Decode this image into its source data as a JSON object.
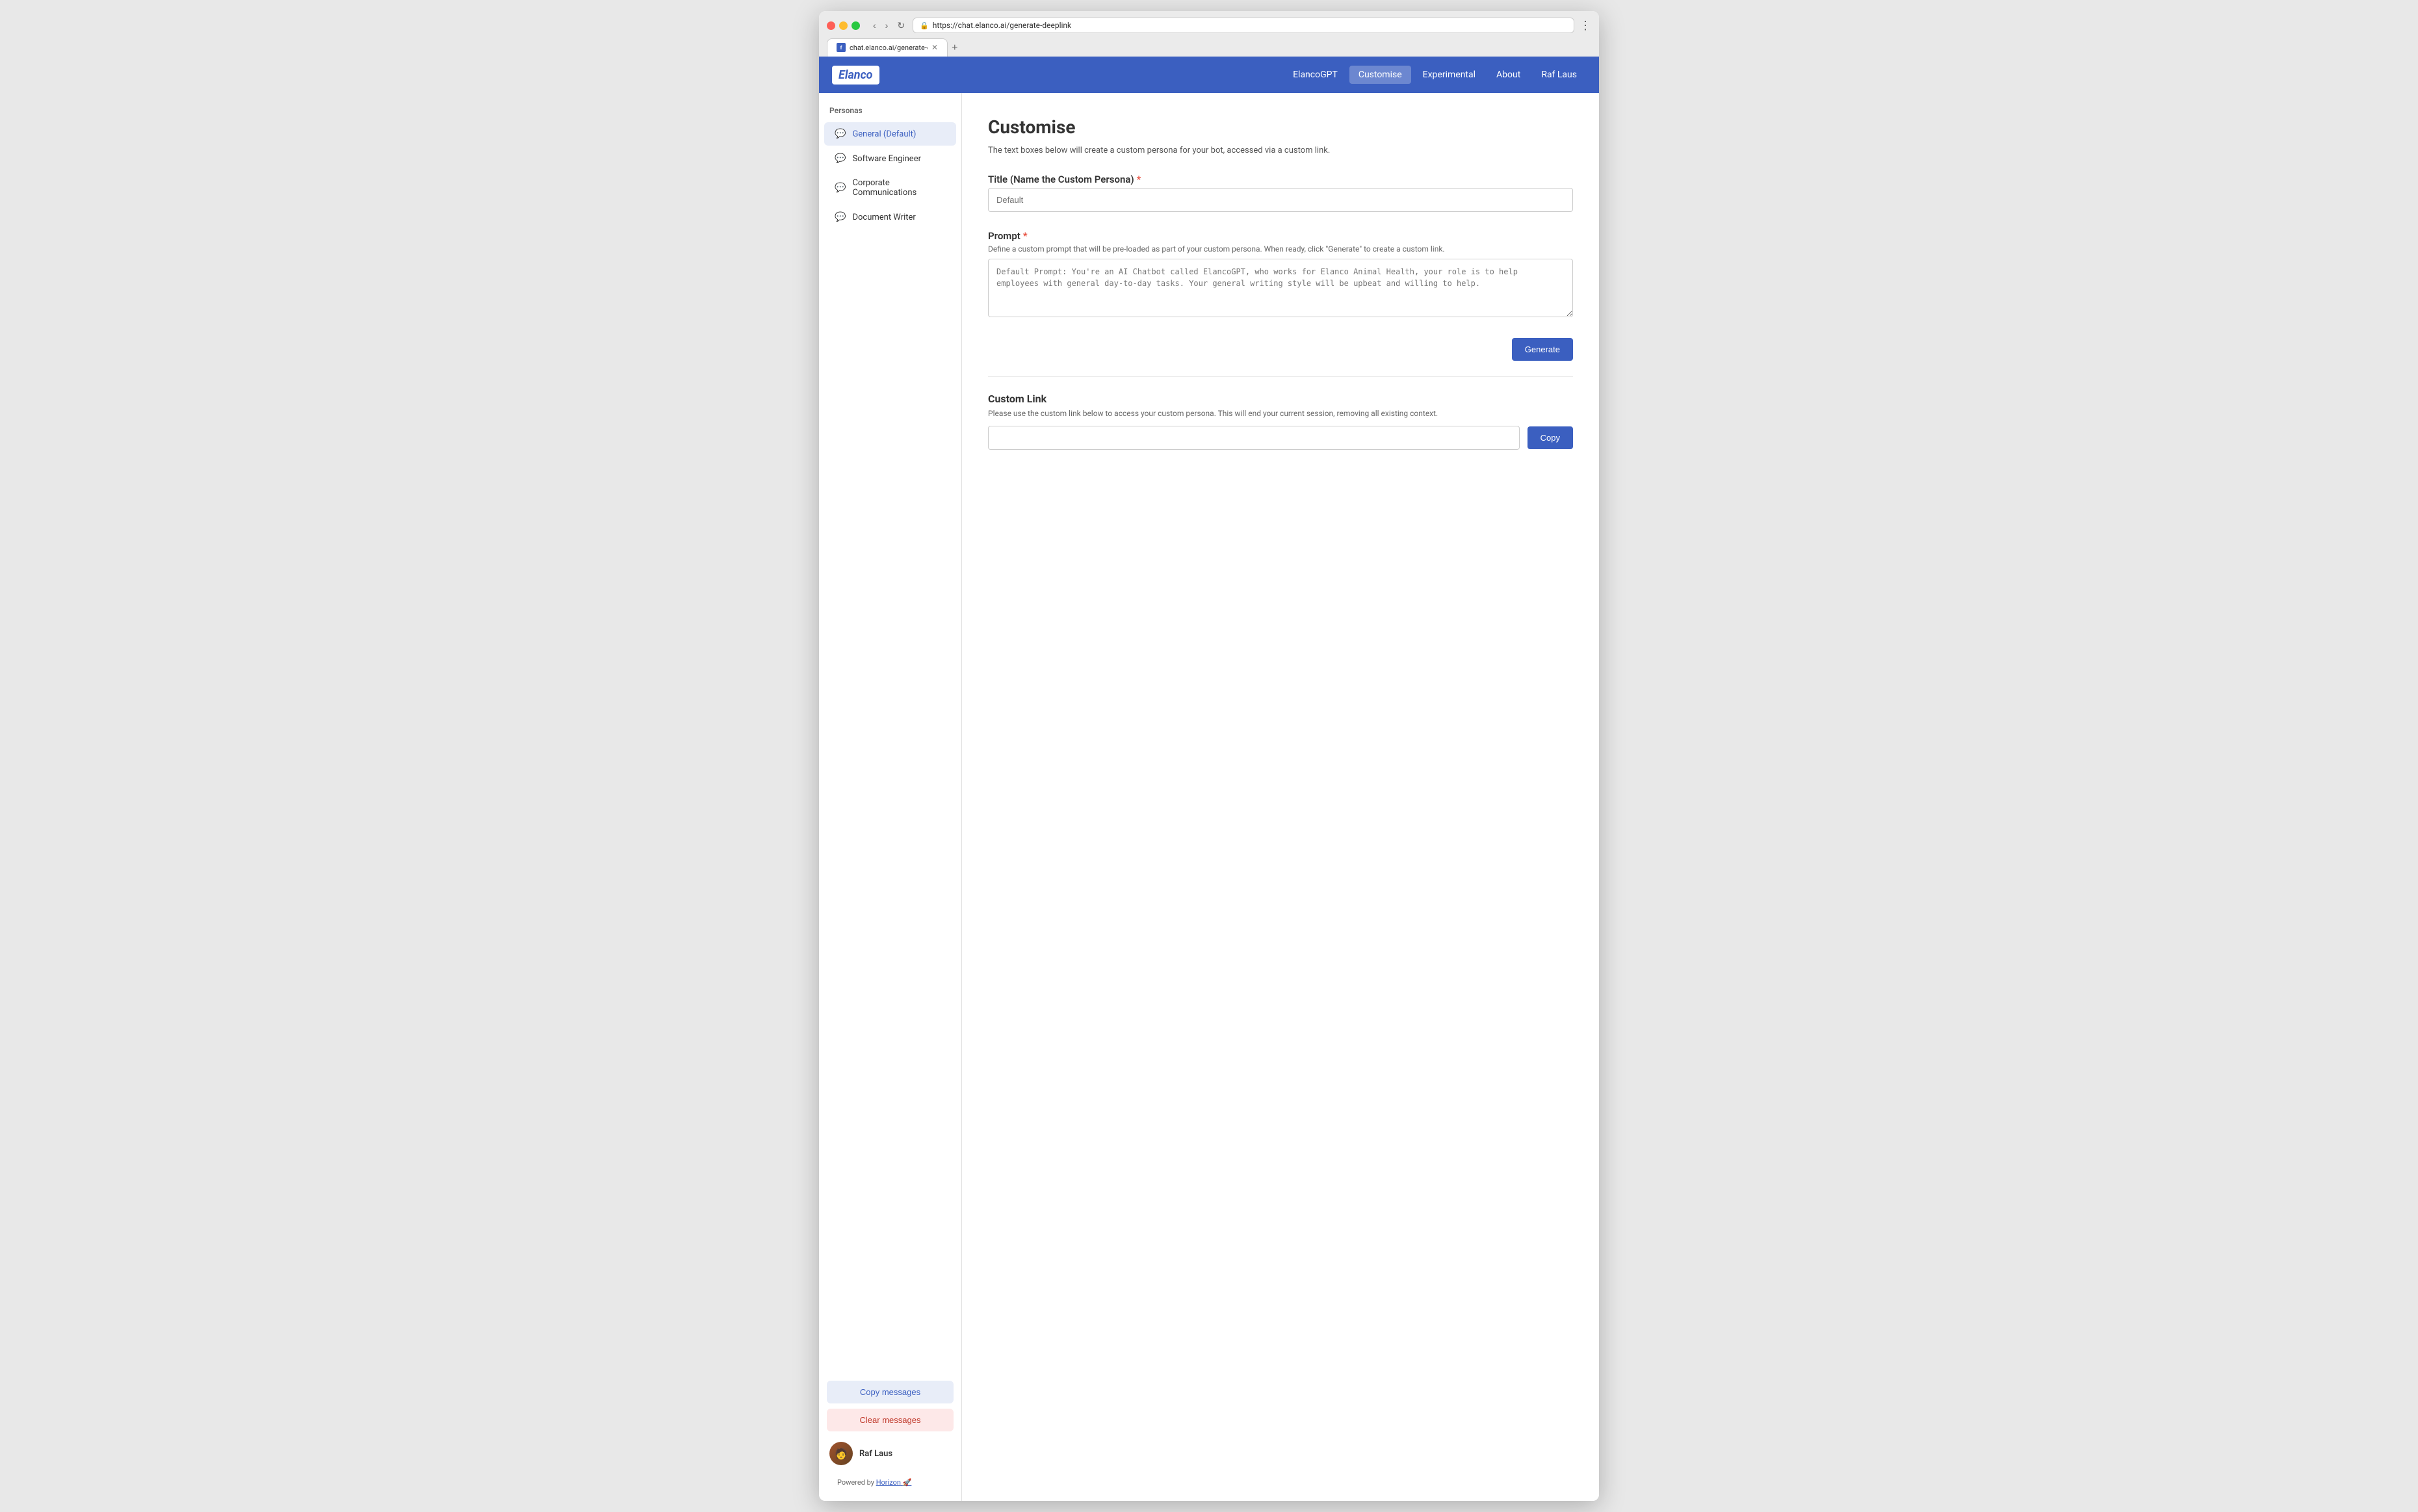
{
  "browser": {
    "url": "https://chat.elanco.ai/generate-deeplink",
    "tab_title": "chat.elanco.ai/generate-deepli...",
    "tab_favicon_letter": "f"
  },
  "nav": {
    "logo": "Elanco",
    "links": [
      {
        "id": "elancogpt",
        "label": "ElancoGPT",
        "active": false
      },
      {
        "id": "customise",
        "label": "Customise",
        "active": true
      },
      {
        "id": "experimental",
        "label": "Experimental",
        "active": false
      },
      {
        "id": "about",
        "label": "About",
        "active": false
      },
      {
        "id": "raflaus",
        "label": "Raf Laus",
        "active": false
      }
    ]
  },
  "sidebar": {
    "section_label": "Personas",
    "items": [
      {
        "id": "general-default",
        "label": "General (Default)",
        "active": true
      },
      {
        "id": "software-engineer",
        "label": "Software Engineer",
        "active": false
      },
      {
        "id": "corporate-communications",
        "label": "Corporate Communications",
        "active": false
      },
      {
        "id": "document-writer",
        "label": "Document Writer",
        "active": false
      }
    ],
    "copy_messages_label": "Copy messages",
    "clear_messages_label": "Clear messages",
    "user_name": "Raf Laus",
    "powered_by_prefix": "Powered by ",
    "horizon_label": "Horizon",
    "horizon_emoji": "🚀"
  },
  "main": {
    "page_title": "Customise",
    "page_desc": "The text boxes below will create a custom persona for your bot, accessed via a custom link.",
    "title_field": {
      "label": "Title (Name the Custom Persona)",
      "required": true,
      "placeholder": "Default",
      "value": ""
    },
    "prompt_field": {
      "label": "Prompt",
      "required": true,
      "desc": "Define a custom prompt that will be pre-loaded as part of your custom persona. When ready, click \"Generate\" to create a custom link.",
      "placeholder": "Default Prompt: You're an AI Chatbot called ElancoGPT, who works for Elanco Animal Health, your role is to help employees with general day-to-day tasks. Your general writing style will be upbeat and willing to help.",
      "value": ""
    },
    "generate_btn_label": "Generate",
    "custom_link": {
      "title": "Custom Link",
      "desc": "Please use the custom link below to access your custom persona. This will end your current session, removing all existing context.",
      "value": "",
      "placeholder": ""
    },
    "copy_btn_label": "Copy"
  }
}
